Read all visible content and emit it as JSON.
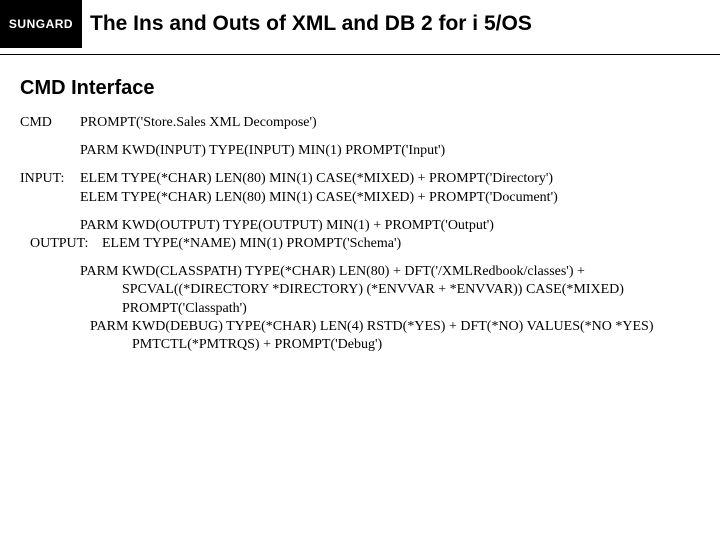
{
  "brand": "SUNGARD",
  "title": "The Ins and Outs of XML and DB 2 for i 5/OS",
  "section": "CMD Interface",
  "rows": {
    "cmd_label": "CMD",
    "cmd_value": "PROMPT('Store.Sales XML Decompose')",
    "parm_input": "PARM       KWD(INPUT) TYPE(INPUT) MIN(1) PROMPT('Input')",
    "input_label": "INPUT:",
    "input_elem1": "ELEM       TYPE(*CHAR) LEN(80) MIN(1) CASE(*MIXED) + PROMPT('Directory')",
    "input_elem2": "ELEM       TYPE(*CHAR) LEN(80) MIN(1) CASE(*MIXED) + PROMPT('Document')",
    "parm_output": "PARM      KWD(OUTPUT) TYPE(OUTPUT) MIN(1) + PROMPT('Output')",
    "output_label": "OUTPUT:",
    "output_elem": "ELEM       TYPE(*NAME) MIN(1) PROMPT('Schema')",
    "parm_classpath": "PARM      KWD(CLASSPATH) TYPE(*CHAR) LEN(80) + DFT('/XMLRedbook/classes') + SPCVAL((*DIRECTORY *DIRECTORY) (*ENVVAR + *ENVVAR)) CASE(*MIXED) PROMPT('Classpath')",
    "parm_debug": "PARM      KWD(DEBUG) TYPE(*CHAR) LEN(4) RSTD(*YES) + DFT(*NO) VALUES(*NO *YES) PMTCTL(*PMTRQS) + PROMPT('Debug')"
  }
}
